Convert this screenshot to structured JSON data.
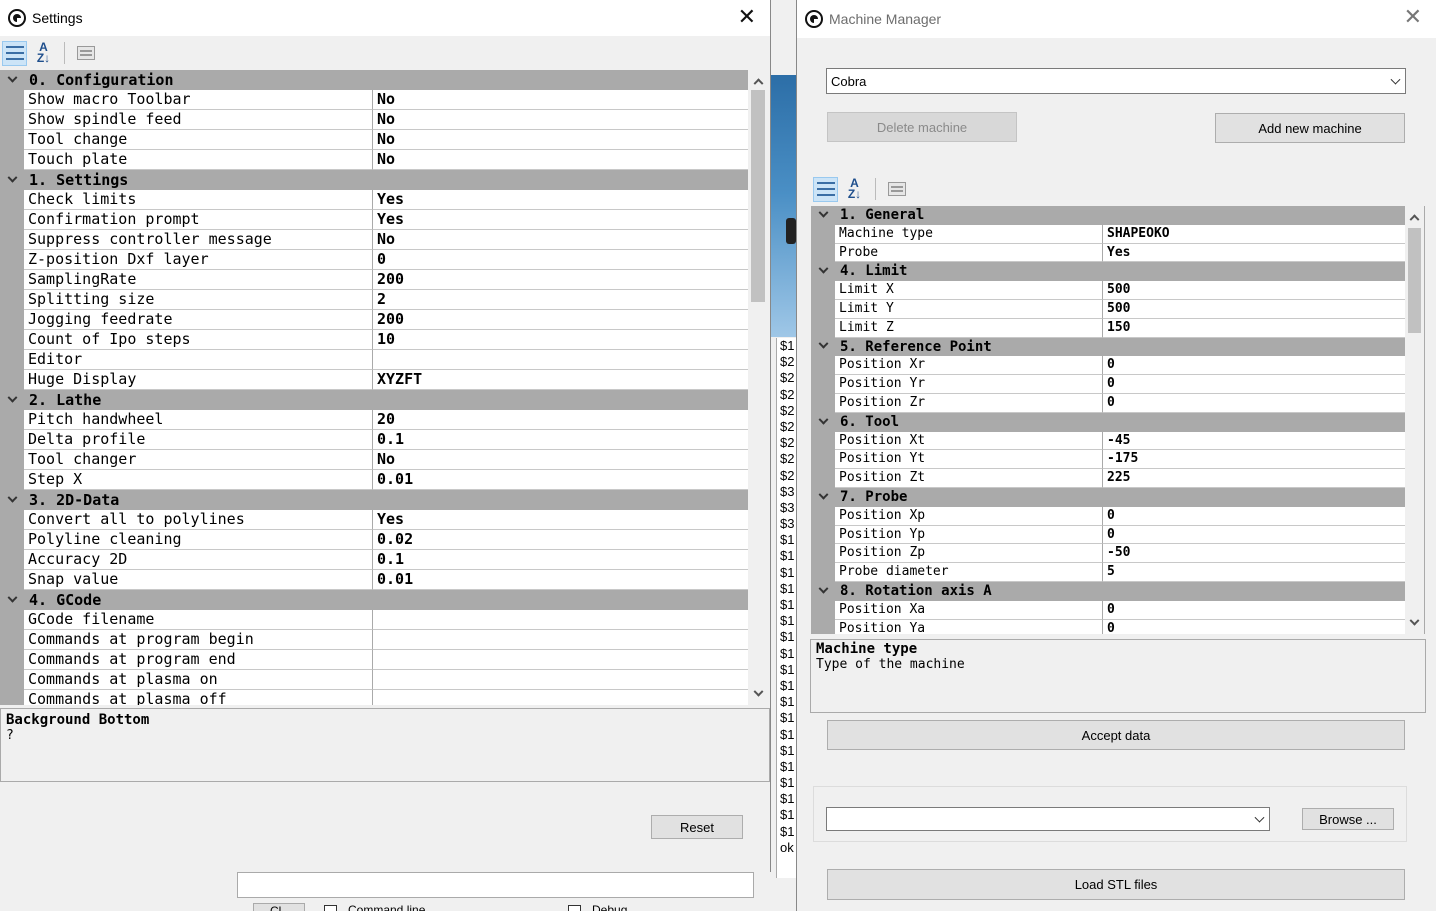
{
  "settings": {
    "title": "Settings",
    "close_glyph": "✕",
    "categories": [
      {
        "label": "0. Configuration",
        "props": [
          {
            "name": "Show macro Toolbar",
            "value": "No"
          },
          {
            "name": "Show spindle feed",
            "value": "No"
          },
          {
            "name": "Tool change",
            "value": "No"
          },
          {
            "name": "Touch plate",
            "value": "No"
          }
        ]
      },
      {
        "label": "1. Settings",
        "props": [
          {
            "name": "Check limits",
            "value": "Yes"
          },
          {
            "name": "Confirmation prompt",
            "value": "Yes"
          },
          {
            "name": "Suppress controller message",
            "value": "No"
          },
          {
            "name": "Z-position Dxf layer",
            "value": "0"
          },
          {
            "name": "SamplingRate",
            "value": "200"
          },
          {
            "name": "Splitting size",
            "value": "2"
          },
          {
            "name": "Jogging feedrate",
            "value": "200"
          },
          {
            "name": "Count of Ipo steps",
            "value": "10"
          },
          {
            "name": "Editor",
            "value": ""
          },
          {
            "name": "Huge Display",
            "value": "XYZFT"
          }
        ]
      },
      {
        "label": "2. Lathe",
        "props": [
          {
            "name": "Pitch handwheel",
            "value": "20"
          },
          {
            "name": "Delta profile",
            "value": "0.1"
          },
          {
            "name": "Tool changer",
            "value": "No"
          },
          {
            "name": "Step X",
            "value": "0.01"
          }
        ]
      },
      {
        "label": "3. 2D-Data",
        "props": [
          {
            "name": "Convert all to polylines",
            "value": "Yes"
          },
          {
            "name": "Polyline cleaning",
            "value": "0.02"
          },
          {
            "name": "Accuracy 2D",
            "value": "0.1"
          },
          {
            "name": "Snap value",
            "value": "0.01"
          }
        ]
      },
      {
        "label": "4. GCode",
        "props": [
          {
            "name": "GCode filename",
            "value": ""
          },
          {
            "name": "Commands at program begin",
            "value": ""
          },
          {
            "name": "Commands at program end",
            "value": ""
          },
          {
            "name": "Commands at plasma on",
            "value": ""
          },
          {
            "name": "Commands at plasma off",
            "value": ""
          }
        ]
      }
    ],
    "description": {
      "title": "Background Bottom",
      "body": "?"
    },
    "reset_label": "Reset",
    "bottom_button_label": "Cl",
    "checkbox1_label": "Command line",
    "checkbox2_label": "Debug"
  },
  "console_lines": [
    "$1",
    "$2",
    "$2",
    "$2",
    "$2",
    "$2",
    "$2",
    "$2",
    "$2",
    "$3",
    "$3",
    "$3",
    "$1",
    "$1",
    "$1",
    "$1",
    "$1",
    "$1",
    "$1",
    "$1",
    "$1",
    "$1",
    "$1",
    "$1",
    "$1",
    "$1",
    "$1",
    "$1",
    "$1",
    "$1",
    "$1",
    "ok"
  ],
  "machine_manager": {
    "title": "Machine Manager",
    "close_glyph": "✕",
    "machine_select": "Cobra",
    "delete_label": "Delete machine",
    "add_label": "Add new machine",
    "categories": [
      {
        "label": "1. General",
        "props": [
          {
            "name": "Machine type",
            "value": "SHAPEOKO"
          },
          {
            "name": "Probe",
            "value": "Yes"
          }
        ]
      },
      {
        "label": "4. Limit",
        "props": [
          {
            "name": "Limit X",
            "value": "500"
          },
          {
            "name": "Limit Y",
            "value": "500"
          },
          {
            "name": "Limit Z",
            "value": "150"
          }
        ]
      },
      {
        "label": "5. Reference Point",
        "props": [
          {
            "name": "Position Xr",
            "value": "0"
          },
          {
            "name": "Position Yr",
            "value": "0"
          },
          {
            "name": "Position Zr",
            "value": "0"
          }
        ]
      },
      {
        "label": "6. Tool",
        "props": [
          {
            "name": "Position Xt",
            "value": "-45"
          },
          {
            "name": "Position Yt",
            "value": "-175"
          },
          {
            "name": "Position Zt",
            "value": "225"
          }
        ]
      },
      {
        "label": "7. Probe",
        "props": [
          {
            "name": "Position Xp",
            "value": "0"
          },
          {
            "name": "Position Yp",
            "value": "0"
          },
          {
            "name": "Position Zp",
            "value": "-50"
          },
          {
            "name": "Probe diameter",
            "value": "5"
          }
        ]
      },
      {
        "label": "8. Rotation axis A",
        "props": [
          {
            "name": "Position Xa",
            "value": "0"
          },
          {
            "name": "Position Ya",
            "value": "0"
          }
        ]
      }
    ],
    "description": {
      "title": "Machine type",
      "body": "Type of the machine"
    },
    "accept_label": "Accept data",
    "file_select": "",
    "browse_label": "Browse ...",
    "load_label": "Load STL files"
  }
}
